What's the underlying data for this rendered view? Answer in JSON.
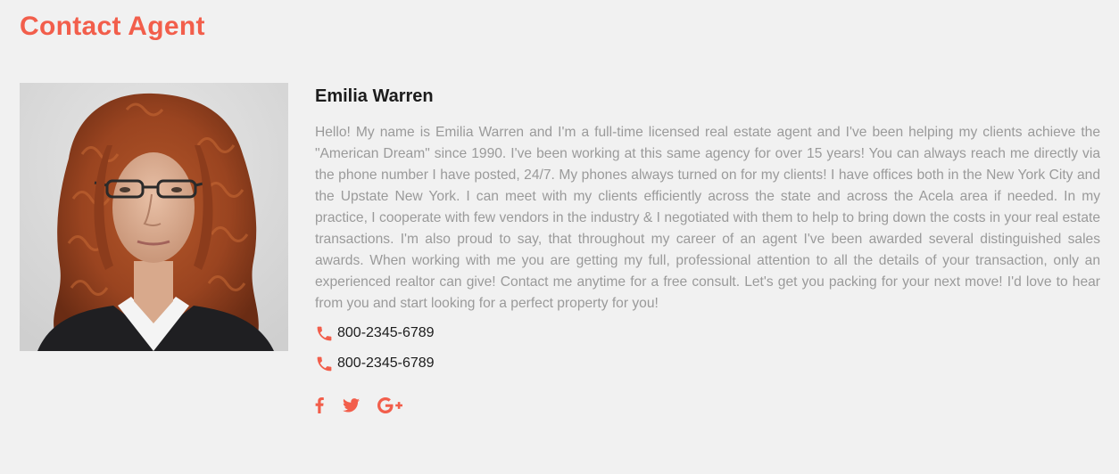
{
  "section": {
    "title": "Contact Agent"
  },
  "agent": {
    "name": "Emilia Warren",
    "photo_alt": "Emilia Warren",
    "bio": "Hello! My name is Emilia Warren and I'm a full-time licensed real estate agent and I've been helping my clients achieve the \"American Dream\" since 1990. I've been working at this same agency for over 15 years! You can always reach me directly via the phone number I have posted, 24/7. My phones always turned on for my clients! I have offices both in the New York City and the Upstate New York. I can meet with my clients efficiently across the state and across the Acela area if needed. In my practice, I cooperate with few vendors in the industry & I negotiated with them to help to bring down the costs in your real estate transactions. I'm also proud to say, that throughout my career of an agent I've been awarded several distinguished sales awards. When working with me you are getting my full, professional attention to all the details of your transaction, only an experienced realtor can give! Contact me anytime for a free consult. Let's get you packing for your next move! I'd love to hear from you and start looking for a perfect property for you!",
    "phones": [
      {
        "icon": "phone-icon",
        "number": "800-2345-6789"
      },
      {
        "icon": "phone-icon",
        "number": "800-2345-6789"
      }
    ]
  },
  "social": {
    "facebook": {
      "icon": "facebook-icon",
      "label": "f"
    },
    "twitter": {
      "icon": "twitter-icon"
    },
    "google_plus": {
      "icon": "google-plus-icon",
      "label": "G+"
    }
  },
  "colors": {
    "accent": "#f25e4b",
    "text_dark": "#1c1c1c",
    "text_muted": "#9a9a9a",
    "background": "#f1f1f1"
  }
}
